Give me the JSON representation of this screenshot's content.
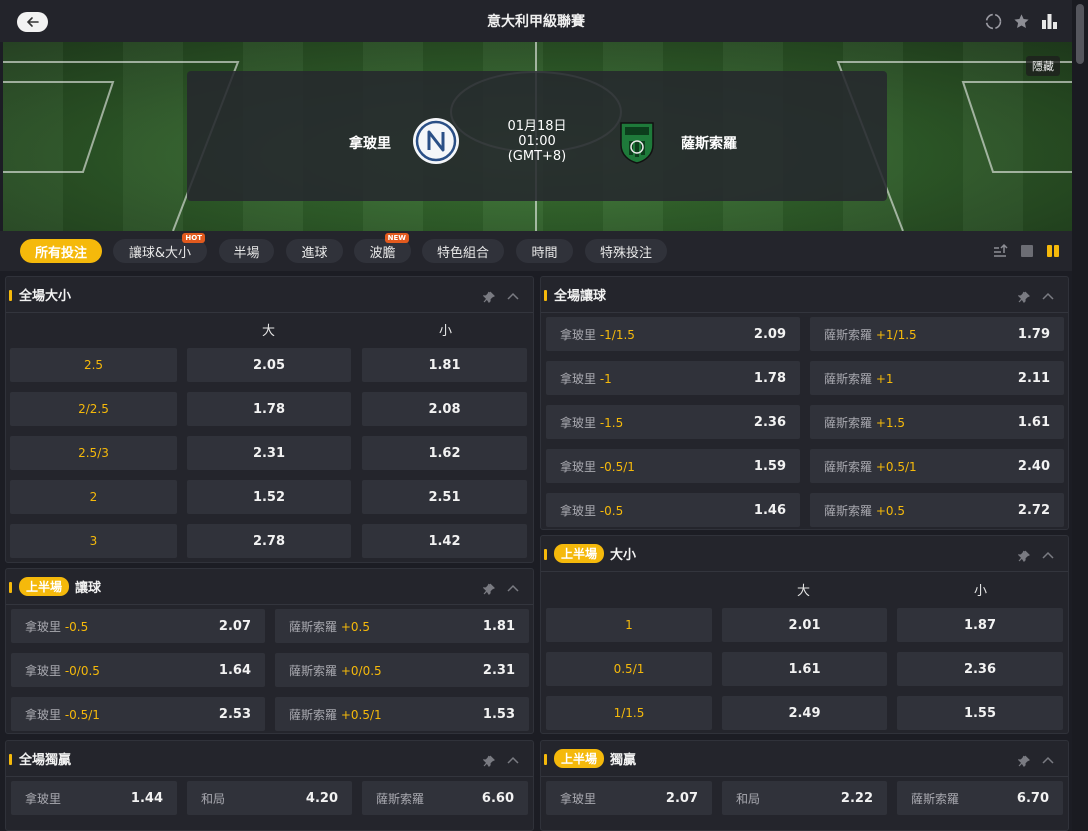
{
  "header": {
    "title": "意大利甲級聯賽"
  },
  "hero": {
    "hide_label": "隱藏",
    "home_team": "拿玻里",
    "away_team": "薩斯索羅",
    "date": "01月18日",
    "time": "01:00",
    "timezone": "(GMT+8)"
  },
  "tabs": [
    {
      "label": "所有投注"
    },
    {
      "label": "讓球&大小",
      "badge": "HOT"
    },
    {
      "label": "半場"
    },
    {
      "label": "進球"
    },
    {
      "label": "波膽",
      "badge": "NEW"
    },
    {
      "label": "特色組合"
    },
    {
      "label": "時間"
    },
    {
      "label": "特殊投注"
    }
  ],
  "colors": {
    "accent": "#f5b90b",
    "panel": "#24252c",
    "cell": "#30323a"
  },
  "ft_ou": {
    "title": "全場大小",
    "over": "大",
    "under": "小",
    "rows": [
      {
        "line": "2.5",
        "over": "2.05",
        "under": "1.81"
      },
      {
        "line": "2/2.5",
        "over": "1.78",
        "under": "2.08"
      },
      {
        "line": "2.5/3",
        "over": "2.31",
        "under": "1.62"
      },
      {
        "line": "2",
        "over": "1.52",
        "under": "2.51"
      },
      {
        "line": "3",
        "over": "2.78",
        "under": "1.42"
      }
    ]
  },
  "ft_hdp": {
    "title": "全場讓球",
    "rows": [
      {
        "home": "拿玻里",
        "home_line": "-1/1.5",
        "home_odd": "2.09",
        "away": "薩斯索羅",
        "away_line": "+1/1.5",
        "away_odd": "1.79"
      },
      {
        "home": "拿玻里",
        "home_line": "-1",
        "home_odd": "1.78",
        "away": "薩斯索羅",
        "away_line": "+1",
        "away_odd": "2.11"
      },
      {
        "home": "拿玻里",
        "home_line": "-1.5",
        "home_odd": "2.36",
        "away": "薩斯索羅",
        "away_line": "+1.5",
        "away_odd": "1.61"
      },
      {
        "home": "拿玻里",
        "home_line": "-0.5/1",
        "home_odd": "1.59",
        "away": "薩斯索羅",
        "away_line": "+0.5/1",
        "away_odd": "2.40"
      },
      {
        "home": "拿玻里",
        "home_line": "-0.5",
        "home_odd": "1.46",
        "away": "薩斯索羅",
        "away_line": "+0.5",
        "away_odd": "2.72"
      }
    ]
  },
  "h1_hdp": {
    "badge": "上半場",
    "title": "讓球",
    "rows": [
      {
        "home": "拿玻里",
        "home_line": "-0.5",
        "home_odd": "2.07",
        "away": "薩斯索羅",
        "away_line": "+0.5",
        "away_odd": "1.81"
      },
      {
        "home": "拿玻里",
        "home_line": "-0/0.5",
        "home_odd": "1.64",
        "away": "薩斯索羅",
        "away_line": "+0/0.5",
        "away_odd": "2.31"
      },
      {
        "home": "拿玻里",
        "home_line": "-0.5/1",
        "home_odd": "2.53",
        "away": "薩斯索羅",
        "away_line": "+0.5/1",
        "away_odd": "1.53"
      }
    ]
  },
  "h1_ou": {
    "badge": "上半場",
    "title": "大小",
    "over": "大",
    "under": "小",
    "rows": [
      {
        "line": "1",
        "over": "2.01",
        "under": "1.87"
      },
      {
        "line": "0.5/1",
        "over": "1.61",
        "under": "2.36"
      },
      {
        "line": "1/1.5",
        "over": "2.49",
        "under": "1.55"
      }
    ]
  },
  "ft_1x2": {
    "title": "全場獨贏",
    "home": "拿玻里",
    "home_odd": "1.44",
    "draw": "和局",
    "draw_odd": "4.20",
    "away": "薩斯索羅",
    "away_odd": "6.60"
  },
  "h1_1x2": {
    "badge": "上半場",
    "title": "獨贏",
    "home": "拿玻里",
    "home_odd": "2.07",
    "draw": "和局",
    "draw_odd": "2.22",
    "away": "薩斯索羅",
    "away_odd": "6.70"
  }
}
